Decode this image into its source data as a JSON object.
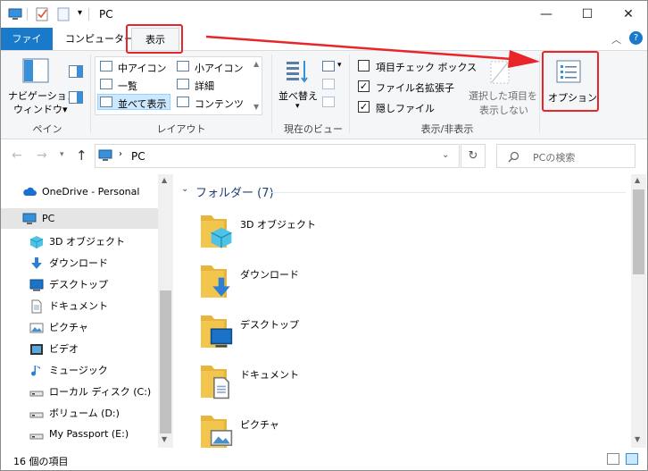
{
  "window": {
    "title": "PC",
    "min_glyph": "—",
    "max_glyph": "☐",
    "close_glyph": "✕"
  },
  "tabs": {
    "file": "ファイル",
    "computer": "コンピューター",
    "view": "表示"
  },
  "ribbon": {
    "pane": {
      "nav_pane_line1": "ナビゲーション",
      "nav_pane_line2": "ウィンドウ▾",
      "group_label": "ペイン"
    },
    "layout": {
      "medium_icons": "中アイコン",
      "small_icons": "小アイコン",
      "list": "一覧",
      "details": "詳細",
      "tiles": "並べて表示",
      "content": "コンテンツ",
      "group_label": "レイアウト"
    },
    "current_view": {
      "sort_by": "並べ替え",
      "group_label": "現在のビュー"
    },
    "show_hide": {
      "item_checkboxes": "項目チェック ボックス",
      "file_extensions": "ファイル名拡張子",
      "hidden_items": "隠しファイル",
      "hide_selected_line1": "選択した項目を",
      "hide_selected_line2": "表示しない",
      "group_label": "表示/非表示",
      "item_checkboxes_checked": false,
      "file_extensions_checked": true,
      "hidden_items_checked": true
    },
    "options": {
      "label": "オプション"
    }
  },
  "address": {
    "path": "PC",
    "search_placeholder": "PCの検索"
  },
  "nav": {
    "items": [
      {
        "label": "OneDrive - Personal",
        "icon": "cloud-icon"
      },
      {
        "label": "PC",
        "icon": "computer-icon"
      },
      {
        "label": "3D オブジェクト",
        "icon": "cube-icon"
      },
      {
        "label": "ダウンロード",
        "icon": "download-icon"
      },
      {
        "label": "デスクトップ",
        "icon": "desktop-icon"
      },
      {
        "label": "ドキュメント",
        "icon": "document-icon"
      },
      {
        "label": "ピクチャ",
        "icon": "picture-icon"
      },
      {
        "label": "ビデオ",
        "icon": "video-icon"
      },
      {
        "label": "ミュージック",
        "icon": "music-icon"
      },
      {
        "label": "ローカル ディスク (C:)",
        "icon": "drive-icon"
      },
      {
        "label": "ボリューム (D:)",
        "icon": "drive-icon"
      },
      {
        "label": "My Passport (E:)",
        "icon": "drive-icon"
      }
    ]
  },
  "content": {
    "group_header": "フォルダー (7)",
    "folders": [
      {
        "label": "3D オブジェクト",
        "icon": "cube-icon"
      },
      {
        "label": "ダウンロード",
        "icon": "download-icon"
      },
      {
        "label": "デスクトップ",
        "icon": "desktop-icon"
      },
      {
        "label": "ドキュメント",
        "icon": "document-icon"
      },
      {
        "label": "ピクチャ",
        "icon": "picture-icon"
      }
    ]
  },
  "status": {
    "item_count": "16 個の項目"
  },
  "colors": {
    "file_tab": "#1979ca",
    "highlight": "#e8262a",
    "selected_nav": "#e5e5e5",
    "folder": "#f2c54c"
  }
}
